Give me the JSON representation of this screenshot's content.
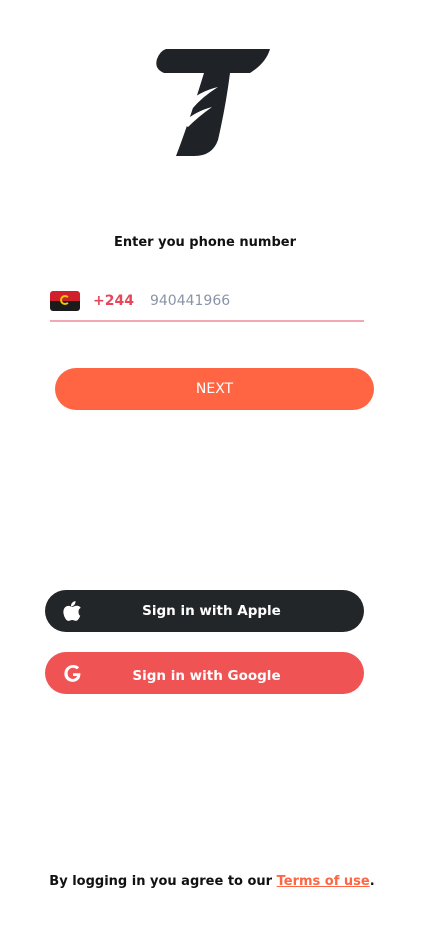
{
  "brand": {
    "logo_icon": "t-logo-icon",
    "accent_color": "#ff6542"
  },
  "login": {
    "prompt": "Enter you phone number",
    "country_flag_icon": "angola-flag-icon",
    "country_code": "+244",
    "phone_value": "940441966",
    "next_label": "NEXT"
  },
  "social": {
    "apple_label": "Sign in with Apple",
    "apple_icon": "apple-icon",
    "google_label": "Sign in with Google",
    "google_icon": "google-icon"
  },
  "footer": {
    "text": "By logging in you agree to our ",
    "terms_link": "Terms of use",
    "suffix": "."
  }
}
